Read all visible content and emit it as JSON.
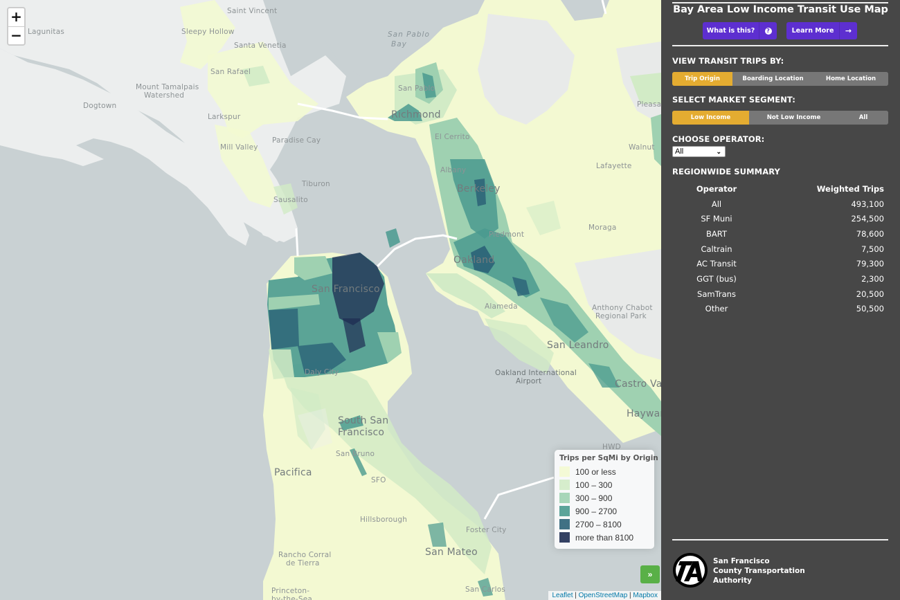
{
  "map": {
    "zoom_in_label": "+",
    "zoom_out_label": "−",
    "place_labels": [
      {
        "text": "Saint Vincent",
        "kind": "normal"
      },
      {
        "text": "Lagunitas",
        "kind": "normal"
      },
      {
        "text": "Sleepy Hollow",
        "kind": "normal"
      },
      {
        "text": "Santa Venetia",
        "kind": "normal"
      },
      {
        "text": "San Rafael",
        "kind": "normal"
      },
      {
        "text": "Mount Tamalpais",
        "kind": "normal"
      },
      {
        "text": "Watershed",
        "kind": "normal"
      },
      {
        "text": "Dogtown",
        "kind": "normal"
      },
      {
        "text": "Larkspur",
        "kind": "normal"
      },
      {
        "text": "Mill Valley",
        "kind": "normal"
      },
      {
        "text": "Paradise Cay",
        "kind": "normal"
      },
      {
        "text": "Tiburon",
        "kind": "normal"
      },
      {
        "text": "Sausalito",
        "kind": "normal"
      },
      {
        "text": "San Pablo",
        "kind": "water"
      },
      {
        "text": "Bay",
        "kind": "water"
      },
      {
        "text": "Richmond",
        "kind": "big"
      },
      {
        "text": "San Pablo",
        "kind": "normal"
      },
      {
        "text": "El Cerrito",
        "kind": "normal"
      },
      {
        "text": "Albany",
        "kind": "normal"
      },
      {
        "text": "Berkeley",
        "kind": "big"
      },
      {
        "text": "Piedmont",
        "kind": "normal"
      },
      {
        "text": "Oakland",
        "kind": "big"
      },
      {
        "text": "Alameda",
        "kind": "normal"
      },
      {
        "text": "Lafayette",
        "kind": "normal"
      },
      {
        "text": "Walnut",
        "kind": "normal"
      },
      {
        "text": "Pleasant",
        "kind": "normal"
      },
      {
        "text": "Moraga",
        "kind": "normal"
      },
      {
        "text": "Anthony Chabot",
        "kind": "normal"
      },
      {
        "text": "Regional Park",
        "kind": "normal"
      },
      {
        "text": "San Francisco",
        "kind": "big"
      },
      {
        "text": "Daly City",
        "kind": "normal"
      },
      {
        "text": "San Leandro",
        "kind": "big"
      },
      {
        "text": "Oakland International",
        "kind": "dark"
      },
      {
        "text": "Airport",
        "kind": "dark"
      },
      {
        "text": "Castro Valley",
        "kind": "big"
      },
      {
        "text": "Hayward",
        "kind": "big"
      },
      {
        "text": "HWD",
        "kind": "normal"
      },
      {
        "text": "South San",
        "kind": "big"
      },
      {
        "text": "Francisco",
        "kind": "big"
      },
      {
        "text": "San Bruno",
        "kind": "normal"
      },
      {
        "text": "SFO",
        "kind": "normal"
      },
      {
        "text": "Pacifica",
        "kind": "big"
      },
      {
        "text": "Hillsborough",
        "kind": "normal"
      },
      {
        "text": "Foster City",
        "kind": "normal"
      },
      {
        "text": "San Mateo",
        "kind": "big"
      },
      {
        "text": "Rancho Corral",
        "kind": "normal"
      },
      {
        "text": "de Tierra",
        "kind": "normal"
      },
      {
        "text": "San Carlos",
        "kind": "normal"
      },
      {
        "text": "Princeton-",
        "kind": "normal"
      },
      {
        "text": "by-the-Sea",
        "kind": "normal"
      }
    ],
    "legend": {
      "title": "Trips per SqMi by Origin",
      "items": [
        {
          "label": "100 or less",
          "color": "#f3f9d2"
        },
        {
          "label": "100 – 300",
          "color": "#d2ebc6"
        },
        {
          "label": "300 – 900",
          "color": "#9fd1b1"
        },
        {
          "label": "900 – 2700",
          "color": "#4a9a8f"
        },
        {
          "label": "2700 – 8100",
          "color": "#2b6277"
        },
        {
          "label": "more than 8100",
          "color": "#1e2c52"
        }
      ]
    },
    "panel_toggle_label": "»",
    "attribution": {
      "leaflet": "Leaflet",
      "sep1": " | ",
      "osm": "OpenStreetMap",
      "sep2": " | ",
      "mapbox": "Mapbox"
    }
  },
  "sidebar": {
    "title": "Bay Area Low Income Transit Use Map",
    "buttons": {
      "what_is_this": "What is this?",
      "what_is_this_icon": "?",
      "learn_more": "Learn More",
      "learn_more_icon": "→"
    },
    "view_trips": {
      "heading": "VIEW TRANSIT TRIPS BY:",
      "options": [
        "Trip Origin",
        "Boarding Location",
        "Home Location"
      ],
      "selected": "Trip Origin"
    },
    "market_segment": {
      "heading": "SELECT MARKET SEGMENT:",
      "options": [
        "Low Income",
        "Not Low Income",
        "All"
      ],
      "selected": "Low Income"
    },
    "operator": {
      "heading": "CHOOSE OPERATOR:",
      "selected": "All"
    },
    "summary": {
      "heading": "REGIONWIDE SUMMARY",
      "col_operator": "Operator",
      "col_trips": "Weighted Trips",
      "rows": [
        {
          "operator": "All",
          "trips": "493,100"
        },
        {
          "operator": "SF Muni",
          "trips": "254,500"
        },
        {
          "operator": "BART",
          "trips": "78,600"
        },
        {
          "operator": "Caltrain",
          "trips": "7,500"
        },
        {
          "operator": "AC Transit",
          "trips": "79,300"
        },
        {
          "operator": "GGT (bus)",
          "trips": "2,300"
        },
        {
          "operator": "SamTrans",
          "trips": "20,500"
        },
        {
          "operator": "Other",
          "trips": "50,500"
        }
      ]
    },
    "org": {
      "line1": "San Francisco",
      "line2": "County Transportation",
      "line3": "Authority",
      "logo_text": "TA"
    },
    "colors": {
      "background": "#474747",
      "accent_button": "#5d2fd0",
      "selected_segment": "#e4ac31",
      "unselected_segment": "#777777"
    }
  }
}
